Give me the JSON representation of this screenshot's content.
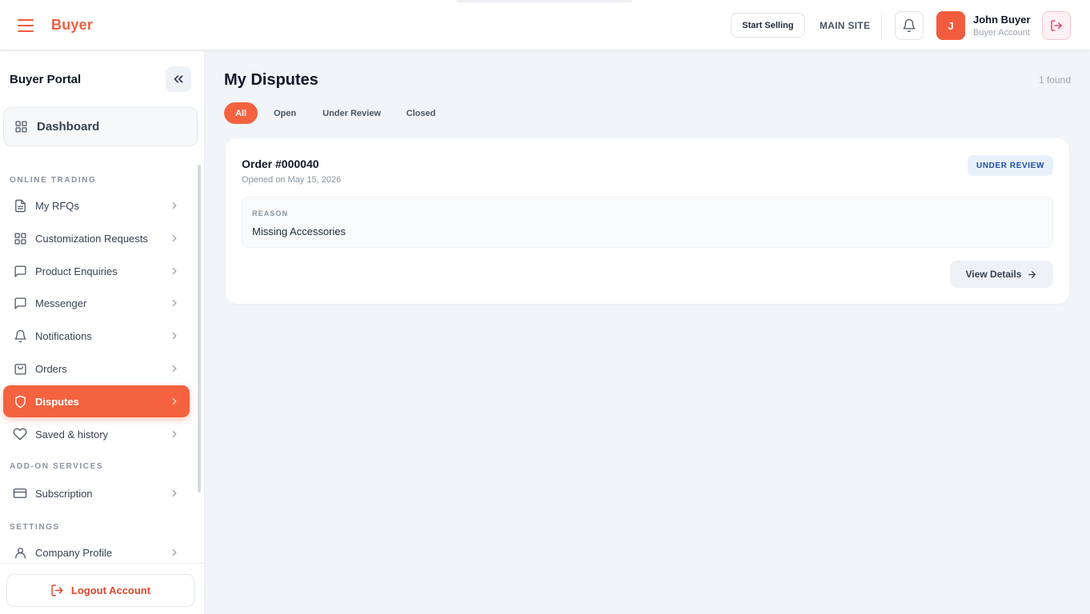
{
  "header": {
    "brand": "Buyer",
    "start_selling_label": "Start Selling",
    "main_site_label": "MAIN SITE",
    "user": {
      "avatar_initial": "J",
      "name": "John Buyer",
      "role": "Buyer Account"
    },
    "accent_color": "#f4623f"
  },
  "sidebar": {
    "title": "Buyer Portal",
    "dashboard_label": "Dashboard",
    "sections": [
      {
        "label": "ONLINE TRADING",
        "items": [
          {
            "label": "My RFQs",
            "icon": "document-icon"
          },
          {
            "label": "Customization Requests",
            "icon": "grid-icon"
          },
          {
            "label": "Product Enquiries",
            "icon": "chat-bubble-icon"
          },
          {
            "label": "Messenger",
            "icon": "message-icon"
          },
          {
            "label": "Notifications",
            "icon": "bell-icon"
          },
          {
            "label": "Orders",
            "icon": "bag-icon"
          },
          {
            "label": "Disputes",
            "icon": "shield-icon",
            "active": true
          },
          {
            "label": "Saved & history",
            "icon": "heart-icon"
          }
        ]
      },
      {
        "label": "ADD-ON SERVICES",
        "items": [
          {
            "label": "Subscription",
            "icon": "credit-card-icon"
          }
        ]
      },
      {
        "label": "SETTINGS",
        "items": [
          {
            "label": "Company Profile",
            "icon": "user-icon"
          }
        ]
      }
    ],
    "logout_label": "Logout Account"
  },
  "main": {
    "title": "My Disputes",
    "found_count": "1 found",
    "filter_tabs": [
      {
        "label": "All",
        "active": true
      },
      {
        "label": "Open",
        "active": false
      },
      {
        "label": "Under Review",
        "active": false
      },
      {
        "label": "Closed",
        "active": false
      }
    ],
    "disputes": [
      {
        "order_id": "Order #000040",
        "opened": "Opened on May 15, 2026",
        "status": "UNDER REVIEW",
        "reason_label": "REASON",
        "reason": "Missing Accessories",
        "view_details_label": "View Details"
      }
    ]
  }
}
